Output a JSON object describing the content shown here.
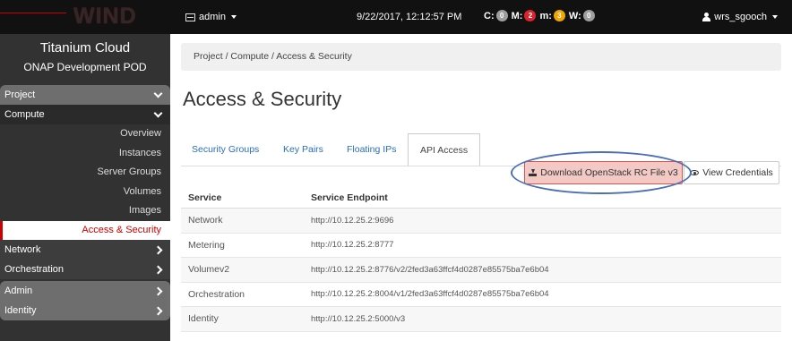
{
  "brand": {
    "logo": "WIND"
  },
  "topbar": {
    "project": "admin",
    "datetime": "9/22/2017, 12:12:57 PM",
    "alarms": [
      {
        "label": "C:",
        "count": "0",
        "color": "#9e9e9e"
      },
      {
        "label": "M:",
        "count": "2",
        "color": "#d9232d"
      },
      {
        "label": "m:",
        "count": "3",
        "color": "#f0a500"
      },
      {
        "label": "W:",
        "count": "0",
        "color": "#9e9e9e"
      }
    ],
    "user": "wrs_sgooch"
  },
  "sidebar": {
    "title": "Titanium Cloud",
    "subtitle": "ONAP Development POD",
    "project": "Project",
    "compute": "Compute",
    "compute_items": [
      "Overview",
      "Instances",
      "Server Groups",
      "Volumes",
      "Images",
      "Access & Security"
    ],
    "network": "Network",
    "orchestration": "Orchestration",
    "admin": "Admin",
    "identity": "Identity"
  },
  "main": {
    "breadcrumb": "Project /  Compute /  Access & Security",
    "title": "Access & Security",
    "tabs": [
      "Security Groups",
      "Key Pairs",
      "Floating IPs",
      "API Access"
    ],
    "download_label": "Download OpenStack RC File v3",
    "view_credentials_label": "View Credentials",
    "table": {
      "headers": [
        "Service",
        "Service Endpoint"
      ],
      "rows": [
        {
          "service": "Network",
          "endpoint": "http://10.12.25.2:9696"
        },
        {
          "service": "Metering",
          "endpoint": "http://10.12.25.2:8777"
        },
        {
          "service": "Volumev2",
          "endpoint": "http://10.12.25.2:8776/v2/2fed3a63ffcf4d0287e85575ba7e6b04"
        },
        {
          "service": "Orchestration",
          "endpoint": "http://10.12.25.2:8004/v1/2fed3a63ffcf4d0287e85575ba7e6b04"
        },
        {
          "service": "Identity",
          "endpoint": "http://10.12.25.2:5000/v3"
        }
      ]
    }
  }
}
